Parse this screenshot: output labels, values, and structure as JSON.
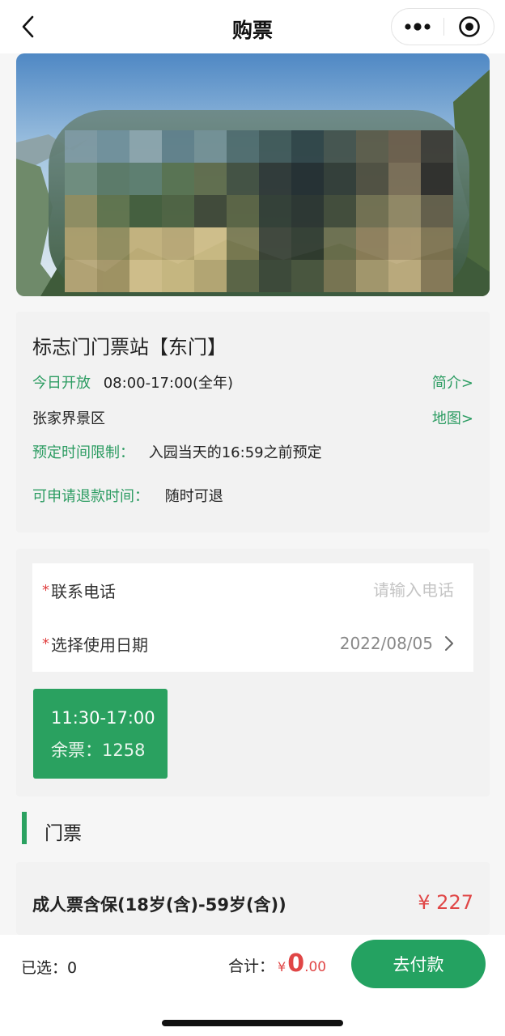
{
  "nav": {
    "title": "购票"
  },
  "banner": {
    "image": "scenic-mountain-photo"
  },
  "info": {
    "station_name": "标志门门票站【东门】",
    "open_label": "今日开放",
    "open_hours": "08:00-17:00(全年)",
    "intro_link": "简介>",
    "area_name": "张家界景区",
    "map_link": "地图>",
    "booking_limit_label": "预定时间限制：",
    "booking_limit_value": "入园当天的16:59之前预定",
    "refund_label": "可申请退款时间：",
    "refund_value": "随时可退"
  },
  "form": {
    "required_mark": "*",
    "phone_label": "联系电话",
    "phone_placeholder": "请输入电话",
    "date_label": "选择使用日期",
    "date_value": "2022/08/05"
  },
  "slot": {
    "time": "11:30-17:00",
    "remaining": "余票：1258"
  },
  "section": {
    "title": "门票"
  },
  "ticket": {
    "name": "成人票含保(18岁(含)-59岁(含))",
    "price": "¥ 227"
  },
  "bottom": {
    "selected": "已选：0",
    "total_label": "合计：",
    "currency": "¥",
    "amount_int": "0",
    "amount_dec": ".00",
    "pay_button": "去付款"
  },
  "colors": {
    "accent_green": "#2aa160",
    "price_red": "#e04646"
  }
}
